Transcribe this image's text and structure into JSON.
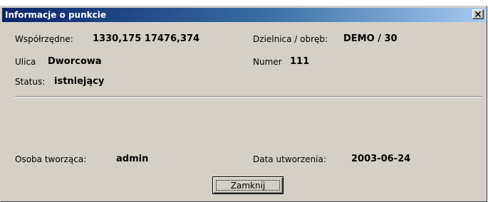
{
  "window": {
    "title": "Informacje o punkcie"
  },
  "fields": {
    "coords_label": "Współrzędne:",
    "coords_value": "1330,175 17476,374",
    "district_label": "Dzielnica / obręb:",
    "district_value": "DEMO / 30",
    "street_label": "Ulica",
    "street_value": "Dworcowa",
    "number_label": "Numer",
    "number_value": "111",
    "status_label": "Status:",
    "status_value": "istniejący",
    "creator_label": "Osoba tworząca:",
    "creator_value": "admin",
    "created_label": "Data utworzenia:",
    "created_value": "2003-06-24"
  },
  "buttons": {
    "close_label": "Zamknij"
  },
  "icons": {
    "close": "close-icon"
  }
}
